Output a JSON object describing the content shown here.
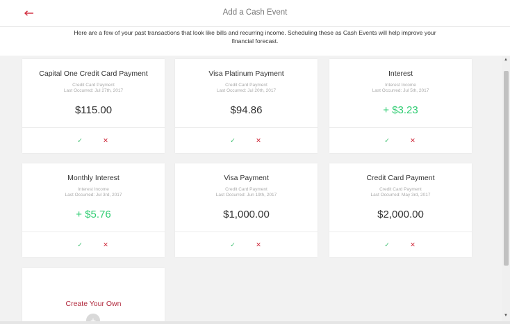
{
  "header": {
    "title": "Add a Cash Event",
    "back_icon": "arrow-left-icon",
    "accent_color": "#d0283a"
  },
  "intro": {
    "text": "Here are a few of your past transactions that look like bills and recurring income. Scheduling these as Cash Events will help improve your financial forecast."
  },
  "cards": [
    {
      "title": "Capital One Credit Card Payment",
      "type": "Credit Card Payment",
      "last": "Last Occurred: Jul 27th, 2017",
      "amount": "$115.00",
      "income": false
    },
    {
      "title": "Visa Platinum Payment",
      "type": "Credit Card Payment",
      "last": "Last Occurred: Jul 20th, 2017",
      "amount": "$94.86",
      "income": false
    },
    {
      "title": "Interest",
      "type": "Interest Income",
      "last": "Last Occurred: Jul 5th, 2017",
      "amount": "+ $3.23",
      "income": true
    },
    {
      "title": "Monthly Interest",
      "type": "Interest Income",
      "last": "Last Occurred: Jul 3rd, 2017",
      "amount": "+ $5.76",
      "income": true
    },
    {
      "title": "Visa Payment",
      "type": "Credit Card Payment",
      "last": "Last Occurred: Jun 19th, 2017",
      "amount": "$1,000.00",
      "income": false
    },
    {
      "title": "Credit Card Payment",
      "type": "Credit Card Payment",
      "last": "Last Occurred: May 3rd, 2017",
      "amount": "$2,000.00",
      "income": false
    }
  ],
  "actions": {
    "accept_symbol": "✓",
    "reject_symbol": "✕",
    "accept_icon": "check-icon",
    "reject_icon": "x-icon"
  },
  "create": {
    "label": "Create Your Own",
    "icon": "plus-icon"
  },
  "colors": {
    "income": "#2ecc71",
    "reject": "#d0283a",
    "accept": "#3cbf6e"
  }
}
